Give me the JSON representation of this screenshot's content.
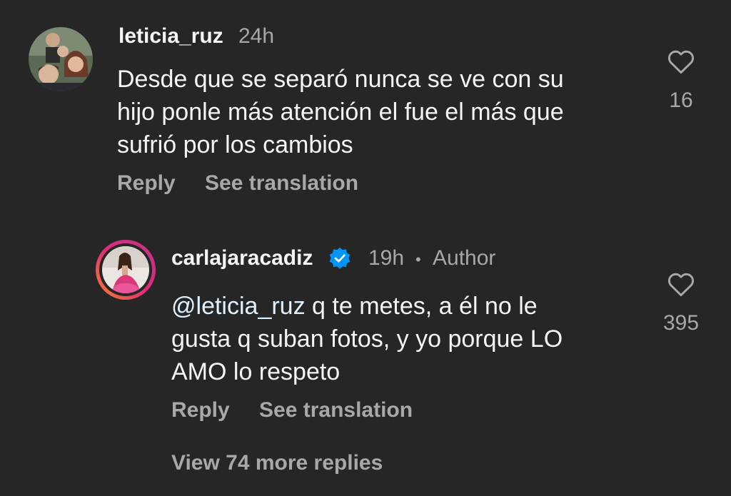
{
  "comments": [
    {
      "username": "leticia_ruz",
      "time": "24h",
      "text": "Desde que se separó nunca se ve con su hijo ponle más atención el fue el más que sufrió por los cambios",
      "text_lines": [
        "Desde que se separó nunca se ve con su",
        "hijo ponle más atención el fue el más que",
        "sufrió por los cambios"
      ],
      "like_count": "16",
      "reply_label": "Reply",
      "translate_label": "See translation"
    }
  ],
  "reply": {
    "username": "carlajaracadiz",
    "verified": true,
    "time": "19h",
    "author_label": "Author",
    "mention": "@leticia_ruz",
    "text_lines": [
      " q te metes, a él no le",
      "gusta q suban fotos, y yo porque LO",
      "AMO lo respeto"
    ],
    "like_count": "395",
    "reply_label": "Reply",
    "translate_label": "See translation"
  },
  "view_more_label": "View 74 more replies",
  "icons": {
    "like": "heart-outline-icon",
    "verified": "verified-badge-icon"
  },
  "colors": {
    "background": "#262626",
    "primary_text": "#f5f5f5",
    "secondary_text": "#a8a8a8",
    "verified_blue": "#0095f6",
    "story_ring_start": "#f58529",
    "story_ring_end": "#dd2a7b"
  }
}
